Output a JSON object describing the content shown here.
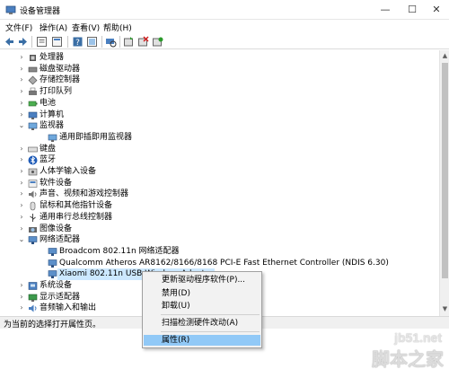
{
  "window": {
    "title": "设备管理器",
    "minimize_glyph": "—",
    "maximize_glyph": "☐",
    "close_glyph": "✕"
  },
  "menu": [
    "文件(F)",
    "操作(A)",
    "查看(V)",
    "帮助(H)"
  ],
  "toolbar": {
    "buttons": [
      "back-icon",
      "forward-icon",
      "properties-icon",
      "show-hidden-icon",
      "help-icon",
      "view-icon",
      "scan-icon",
      "update-driver-icon",
      "uninstall-icon",
      "disable-icon"
    ]
  },
  "tree": {
    "items": [
      {
        "label": "处理器",
        "icon": "cpu-icon",
        "state": "collapsed"
      },
      {
        "label": "磁盘驱动器",
        "icon": "disk-icon",
        "state": "collapsed"
      },
      {
        "label": "存储控制器",
        "icon": "storage-icon",
        "state": "collapsed"
      },
      {
        "label": "打印队列",
        "icon": "printer-icon",
        "state": "collapsed"
      },
      {
        "label": "电池",
        "icon": "battery-icon",
        "state": "collapsed"
      },
      {
        "label": "计算机",
        "icon": "computer-icon",
        "state": "collapsed"
      },
      {
        "label": "监视器",
        "icon": "monitor-icon",
        "state": "expanded"
      },
      {
        "label": "通用即插即用监视器",
        "icon": "monitor-icon",
        "state": "child"
      },
      {
        "label": "键盘",
        "icon": "keyboard-icon",
        "state": "collapsed"
      },
      {
        "label": "蓝牙",
        "icon": "bluetooth-icon",
        "state": "collapsed"
      },
      {
        "label": "人体学输入设备",
        "icon": "hid-icon",
        "state": "collapsed"
      },
      {
        "label": "软件设备",
        "icon": "software-icon",
        "state": "collapsed"
      },
      {
        "label": "声音、视频和游戏控制器",
        "icon": "sound-icon",
        "state": "collapsed"
      },
      {
        "label": "鼠标和其他指针设备",
        "icon": "mouse-icon",
        "state": "collapsed"
      },
      {
        "label": "通用串行总线控制器",
        "icon": "usb-icon",
        "state": "collapsed"
      },
      {
        "label": "图像设备",
        "icon": "camera-icon",
        "state": "collapsed"
      },
      {
        "label": "网络适配器",
        "icon": "network-icon",
        "state": "expanded"
      },
      {
        "label": "Broadcom 802.11n 网络适配器",
        "icon": "network-icon",
        "state": "child"
      },
      {
        "label": "Qualcomm Atheros AR8162/8166/8168 PCI-E Fast Ethernet Controller (NDIS 6.30)",
        "icon": "network-icon",
        "state": "child"
      },
      {
        "label": "Xiaomi 802.11n USB Wireless Adapter",
        "icon": "network-icon",
        "state": "child-selected"
      },
      {
        "label": "系统设备",
        "icon": "system-icon",
        "state": "collapsed"
      },
      {
        "label": "显示适配器",
        "icon": "display-icon",
        "state": "collapsed"
      },
      {
        "label": "音频输入和输出",
        "icon": "audio-icon",
        "state": "collapsed"
      }
    ]
  },
  "context_menu": {
    "items": [
      {
        "label": "更新驱动程序软件(P)...",
        "highlighted": false
      },
      {
        "label": "禁用(D)",
        "highlighted": false
      },
      {
        "label": "卸载(U)",
        "highlighted": false
      },
      {
        "label": "扫描检测硬件改动(A)",
        "highlighted": false
      },
      {
        "label": "属性(R)",
        "highlighted": true
      }
    ]
  },
  "status": {
    "text": "为当前的选择打开属性页。"
  },
  "watermark": {
    "url": "jb51.net",
    "name": "脚本之家"
  },
  "colors": {
    "selection": "#cce8ff",
    "menu_highlight": "#91c9f7",
    "menu_bg": "#f2f2f2"
  }
}
